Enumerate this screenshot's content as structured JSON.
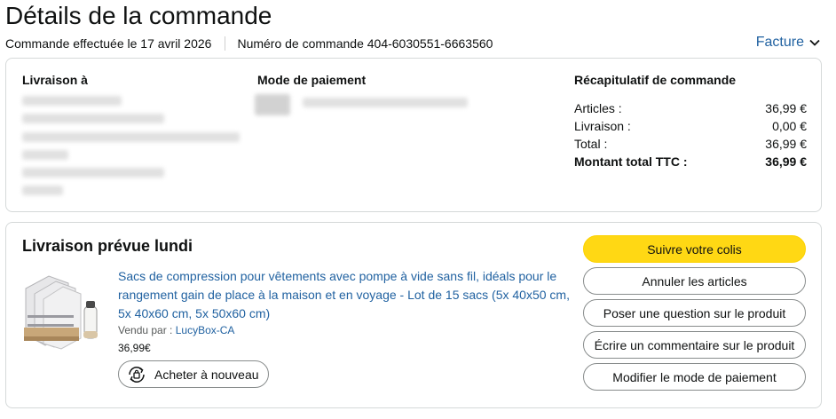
{
  "header": {
    "title": "Détails de la commande",
    "order_date": "Commande effectuée le 17 avril 2026",
    "order_number": "Numéro de commande 404-6030551-6663560",
    "invoice_label": "Facture"
  },
  "shipping": {
    "heading": "Livraison à"
  },
  "payment": {
    "heading": "Mode de paiement"
  },
  "summary": {
    "heading": "Récapitulatif de commande",
    "rows": [
      {
        "label": "Articles :",
        "value": "36,99 €"
      },
      {
        "label": "Livraison :",
        "value": "0,00 €"
      },
      {
        "label": "Total :",
        "value": "36,99 €"
      }
    ],
    "grand_total": {
      "label": "Montant total TTC :",
      "value": "36,99 €"
    }
  },
  "delivery": {
    "title": "Livraison prévue lundi",
    "product": {
      "title": "Sacs de compression pour vêtements avec pompe à vide sans fil, idéals pour le rangement gain de place à la maison et en voyage - Lot de 15 sacs (5x 40x50 cm, 5x 40x60 cm, 5x 50x60 cm)",
      "seller_prefix": "Vendu par  : ",
      "seller_name": "LucyBox-CA",
      "price": "36,99€",
      "buy_again": "Acheter à nouveau"
    },
    "actions": [
      "Suivre votre colis",
      "Annuler les articles",
      "Poser une question sur le produit",
      "Écrire un commentaire sur le produit",
      "Modifier le mode de paiement"
    ]
  },
  "colors": {
    "link": "#2162a1",
    "primary_button": "#ffd814",
    "border": "#d5d9d9"
  }
}
